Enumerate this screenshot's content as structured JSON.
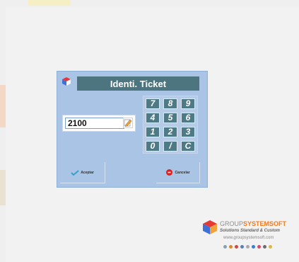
{
  "dialog": {
    "title": "Identi. Ticket",
    "ticket_value": "2100"
  },
  "keypad": {
    "keys": [
      "7",
      "8",
      "9",
      "4",
      "5",
      "6",
      "1",
      "2",
      "3",
      "0",
      "/",
      "C"
    ]
  },
  "actions": {
    "accept_label": "Aceptar",
    "cancel_label": "Cancelar"
  },
  "brand": {
    "name_part1": "GROUP",
    "name_part2": "SYSTEMSOFT",
    "tagline": "Solutions Standard & Custom",
    "url": "www.groupsystemsoft.com"
  },
  "colors": {
    "dialog_bg": "#a9c4e4",
    "title_bar": "#4c7580",
    "key_bg": "#4d7a85",
    "brand_orange": "#f07a1a"
  }
}
